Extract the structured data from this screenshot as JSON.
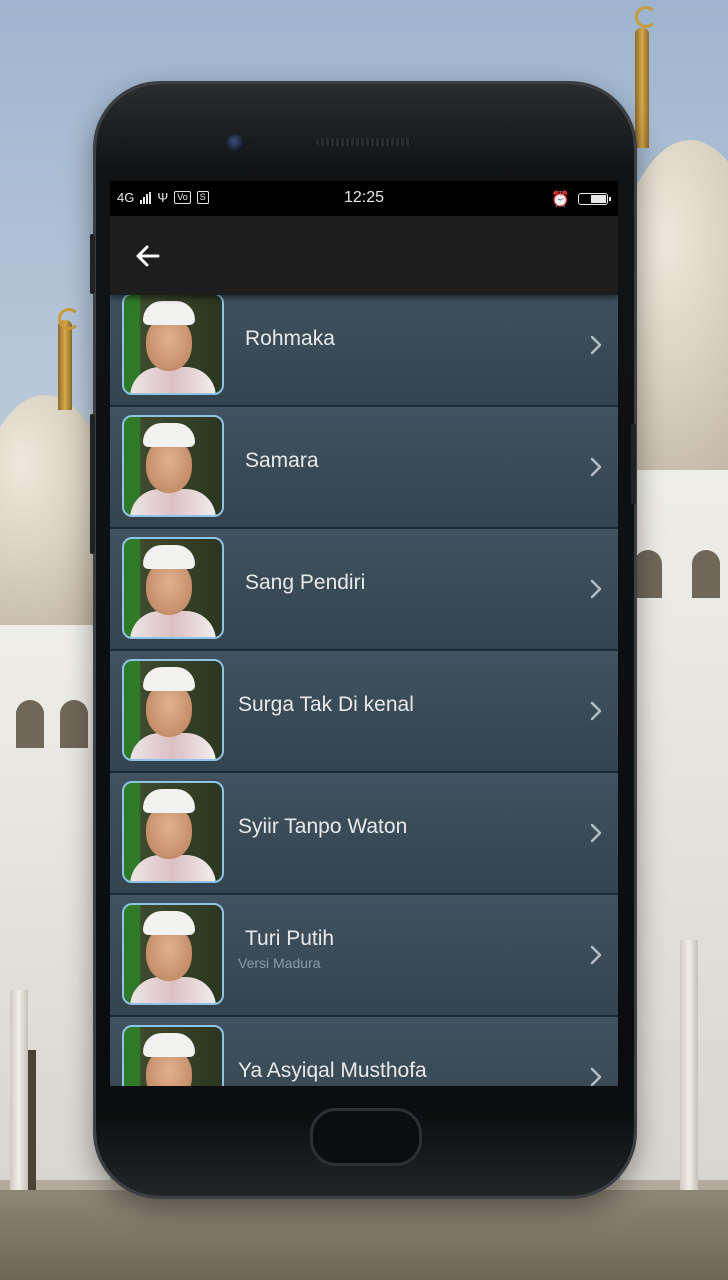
{
  "status_bar": {
    "network": "4G",
    "time": "12:25",
    "icons": [
      "signal-icon",
      "usb-icon",
      "volte-icon",
      "sim-icon",
      "alarm-icon",
      "battery-icon"
    ]
  },
  "app_bar": {
    "back_icon": "arrow-left-icon"
  },
  "list": {
    "items": [
      {
        "title": "Rohmaka",
        "subtitle": ""
      },
      {
        "title": "Samara",
        "subtitle": ""
      },
      {
        "title": "Sang Pendiri",
        "subtitle": ""
      },
      {
        "title": "Surga Tak Di kenal",
        "subtitle": ""
      },
      {
        "title": "Syiir Tanpo Waton",
        "subtitle": ""
      },
      {
        "title": "Turi Putih",
        "subtitle": "Versi Madura"
      },
      {
        "title": "Ya Asyiqal Musthofa",
        "subtitle": ""
      }
    ],
    "chevron_icon": "chevron-right-icon"
  },
  "colors": {
    "list_bg": "#3a4c59",
    "app_bar_bg": "#1d1d1d",
    "status_bar_bg": "#000000",
    "thumb_border": "#8ec3e6"
  }
}
